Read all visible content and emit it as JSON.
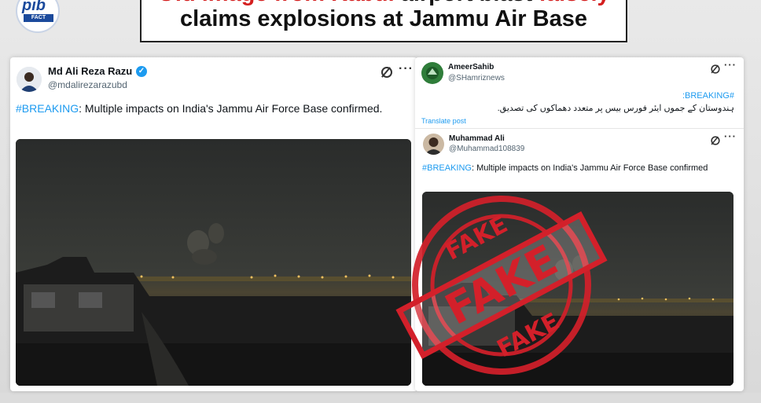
{
  "headline": {
    "line1_a": "Old image from Kabul",
    "line1_b": " airport blast ",
    "line1_c": "falsely",
    "line2": "claims explosions at Jammu Air Base"
  },
  "logo": {
    "brand": "pib",
    "sub": "FACT CHECK"
  },
  "left_post": {
    "name": "Md Ali Reza Razu",
    "handle": "@mdalirezarazubd",
    "hashtag": "#BREAKING",
    "text": ": Multiple impacts on India's Jammu Air Force Base confirmed."
  },
  "right_post_1": {
    "name": "AmeerSahib",
    "handle": "@SHamriznews",
    "hashtag": "#BREAKING:",
    "urdu_text": "ہندوستان کے جموں ایئر فورس بیس پر متعدد دھماکوں کی تصدیق.",
    "translate": "Translate post"
  },
  "right_post_2": {
    "name": "Muhammad Ali",
    "handle": "@Muhammad108839",
    "hashtag": "#BREAKING",
    "text": ": Multiple impacts on India's Jammu Air Force Base confirmed"
  },
  "stamp": {
    "word": "FAKE",
    "color": "#d3202a"
  },
  "colors": {
    "accent": "#1d9bf0",
    "red": "#d41f1f"
  }
}
